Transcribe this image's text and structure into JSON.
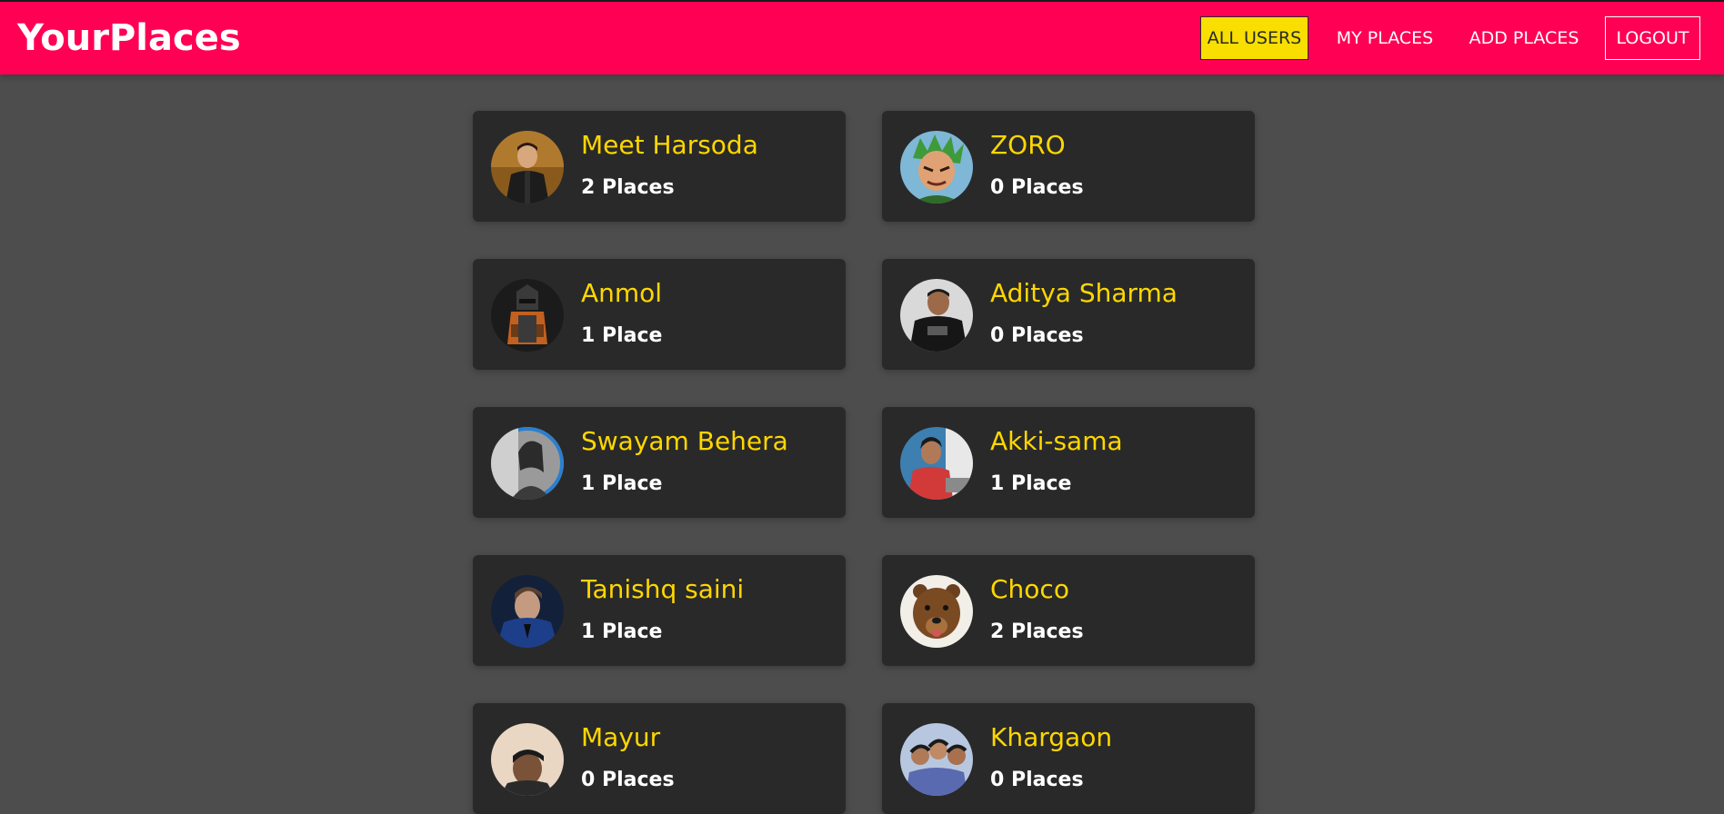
{
  "app": {
    "logo": "YourPlaces"
  },
  "nav": [
    {
      "label": "ALL USERS",
      "active": true
    },
    {
      "label": "MY PLACES",
      "active": false
    },
    {
      "label": "ADD PLACES",
      "active": false
    },
    {
      "label": "LOGOUT",
      "active": false
    }
  ],
  "colors": {
    "header_bg": "#ff0055",
    "page_bg": "#4d4d4d",
    "card_bg": "#292929",
    "name_color": "#ffd700",
    "active_nav_bg": "#f8df00"
  },
  "users": [
    {
      "name": "Meet Harsoda",
      "places": "2 Places",
      "avatar": "person-dark-jacket"
    },
    {
      "name": "ZORO",
      "places": "0 Places",
      "avatar": "anime-green-hair"
    },
    {
      "name": "Anmol",
      "places": "1 Place",
      "avatar": "ninja-character"
    },
    {
      "name": "Aditya Sharma",
      "places": "0 Places",
      "avatar": "person-black-tshirt"
    },
    {
      "name": "Swayam Behera",
      "places": "1 Place",
      "avatar": "black-white-portrait"
    },
    {
      "name": "Akki-sama",
      "places": "1 Place",
      "avatar": "person-red-shirt"
    },
    {
      "name": "Tanishq saini",
      "places": "1 Place",
      "avatar": "man-blue-suit"
    },
    {
      "name": "Choco",
      "places": "2 Places",
      "avatar": "brown-bear"
    },
    {
      "name": "Mayur",
      "places": "0 Places",
      "avatar": "person-indoor"
    },
    {
      "name": "Khargaon",
      "places": "0 Places",
      "avatar": "group-selfie"
    }
  ]
}
